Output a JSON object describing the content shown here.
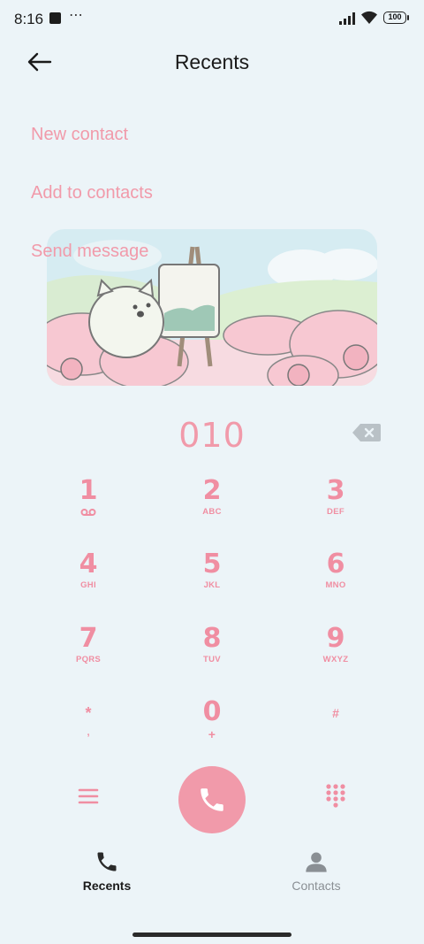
{
  "status_bar": {
    "time": "8:16",
    "more_icon": "⋯",
    "battery": "100"
  },
  "header": {
    "title": "Recents",
    "back_icon": "arrow-left-icon"
  },
  "menu": {
    "new_contact": "New contact",
    "add_to_contacts": "Add to contacts",
    "send_message": "Send message"
  },
  "dialer": {
    "number": "010",
    "keys": [
      {
        "digit": "1",
        "letters": ""
      },
      {
        "digit": "2",
        "letters": "ABC"
      },
      {
        "digit": "3",
        "letters": "DEF"
      },
      {
        "digit": "4",
        "letters": "GHI"
      },
      {
        "digit": "5",
        "letters": "JKL"
      },
      {
        "digit": "6",
        "letters": "MNO"
      },
      {
        "digit": "7",
        "letters": "PQRS"
      },
      {
        "digit": "8",
        "letters": "TUV"
      },
      {
        "digit": "9",
        "letters": "WXYZ"
      }
    ],
    "star": {
      "symbol": "*",
      "sub": ","
    },
    "zero": {
      "digit": "0",
      "sub": "+"
    },
    "hash": {
      "symbol": "#"
    }
  },
  "bottom_nav": {
    "recents": "Recents",
    "contacts": "Contacts"
  },
  "colors": {
    "accent": "#f19aaa",
    "background": "#ecf4f8"
  }
}
